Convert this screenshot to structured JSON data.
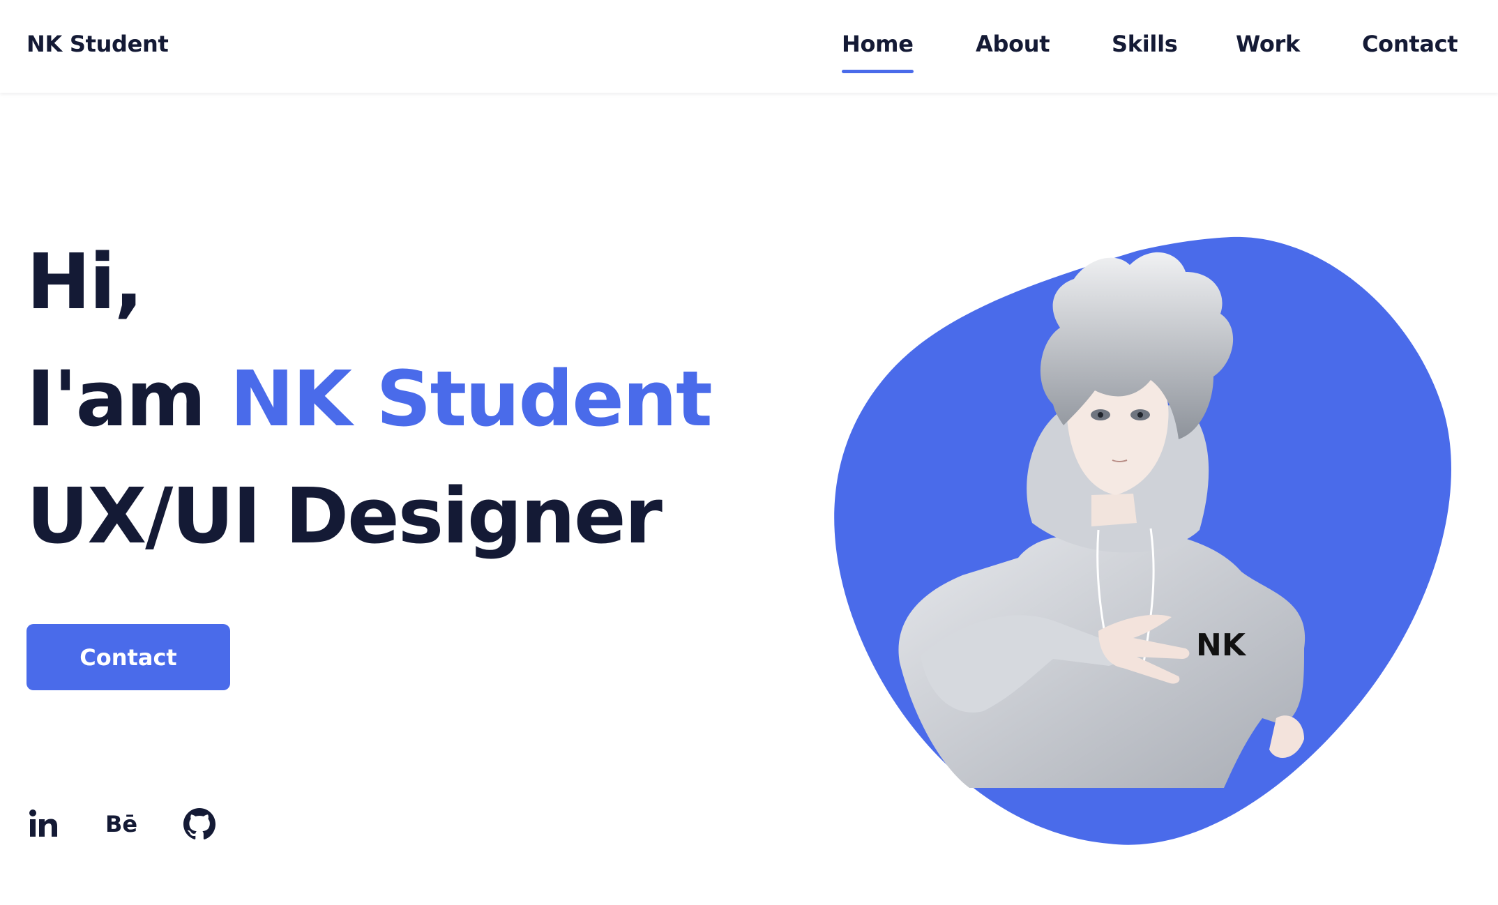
{
  "header": {
    "logo": "NK Student",
    "nav": [
      {
        "label": "Home",
        "active": true
      },
      {
        "label": "About",
        "active": false
      },
      {
        "label": "Skills",
        "active": false
      },
      {
        "label": "Work",
        "active": false
      },
      {
        "label": "Contact",
        "active": false
      }
    ]
  },
  "hero": {
    "line1": "Hi,",
    "line2_prefix": "I'am ",
    "line2_name": "NK Student",
    "line3": "UX/UI Designer",
    "cta_label": "Contact"
  },
  "social": [
    {
      "icon": "linkedin-icon",
      "text": "in"
    },
    {
      "icon": "behance-icon",
      "text": "Bē"
    },
    {
      "icon": "github-icon"
    }
  ],
  "avatar": {
    "badge_text": "NK"
  },
  "colors": {
    "accent": "#4a6bea",
    "text": "#141a35",
    "background": "#ffffff"
  }
}
